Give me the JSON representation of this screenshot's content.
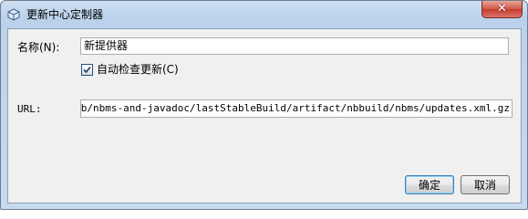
{
  "window": {
    "title": "更新中心定制器",
    "close_label": "✕"
  },
  "form": {
    "name_label": "名称(N):",
    "name_value": "新提供器",
    "auto_check_label": "自动检查更新(C)",
    "auto_check_checked": true,
    "url_label": "URL:",
    "url_value": "dson/job/nbms-and-javadoc/lastStableBuild/artifact/nbbuild/nbms/updates.xml.gz"
  },
  "buttons": {
    "ok_label": "确定",
    "cancel_label": "取消"
  },
  "icons": {
    "app": "netbeans-cube-icon",
    "close": "close-icon",
    "check": "checkmark-icon"
  }
}
